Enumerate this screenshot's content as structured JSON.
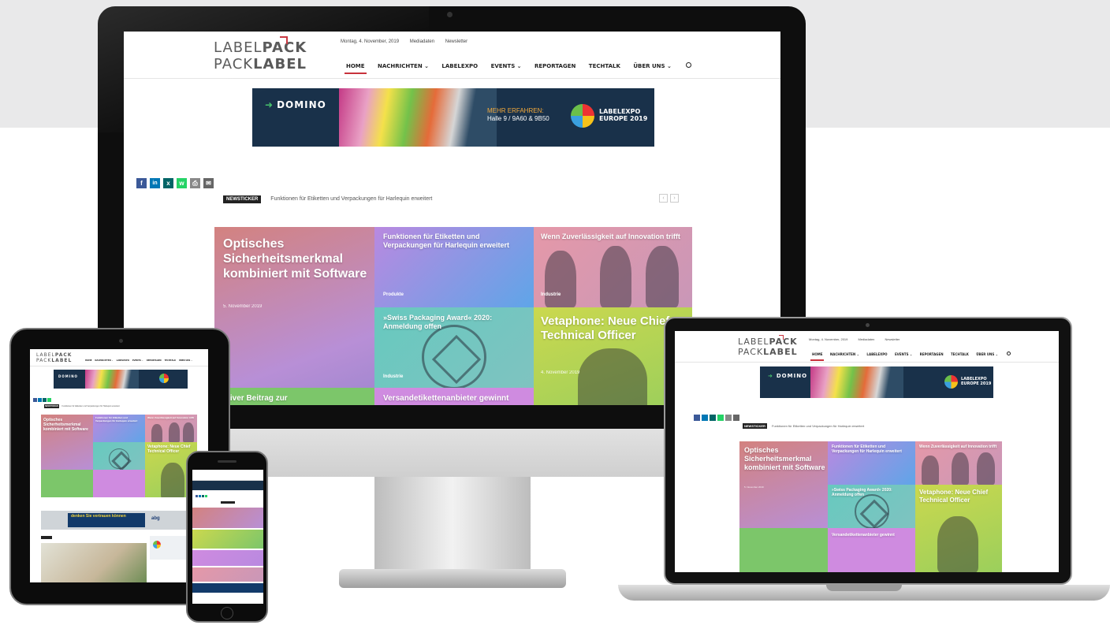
{
  "site": {
    "logo": {
      "line1_light": "LABEL",
      "line1_bold": "PACK",
      "line2_light": "PACK",
      "line2_bold": "LABEL"
    },
    "topbar": {
      "date": "Montag, 4. November, 2019",
      "mediadaten": "Mediadaten",
      "newsletter": "Newsletter"
    },
    "nav": [
      "HOME",
      "NACHRICHTEN ⌄",
      "LABELEXPO",
      "EVENTS ⌄",
      "REPORTAGEN",
      "TECHTALK",
      "ÜBER UNS ⌄"
    ],
    "banner": {
      "brand": "DOMINO",
      "cta_line1": "MEHR ERFAHREN:",
      "cta_line2": "Halle 9 / 9A60 & 9B50",
      "expo_line1": "LABELEXPO",
      "expo_line2": "EUROPE 2019"
    },
    "share_icons": [
      "f",
      "in",
      "x",
      "w",
      "⎙",
      "✉"
    ],
    "ticker": {
      "tag": "NEWSTICKER",
      "text": "Funktionen für Etiketten und Verpackungen für Harlequin erweitert",
      "prev": "‹",
      "next": "›"
    },
    "tiles": [
      {
        "title": "Optisches Sicherheitsmerkmal kombiniert mit Software",
        "date": "5. November 2019",
        "category": ""
      },
      {
        "title": "Funktionen für Etiketten und Verpackungen für Harlequin erweitert",
        "date": "",
        "category": "Produkte"
      },
      {
        "title": "Wenn Zuverlässigkeit auf Innovation trifft",
        "date": "",
        "category": "Industrie"
      },
      {
        "title": "»Swiss Packaging Award« 2020: Anmeldung offen",
        "date": "",
        "category": "Industrie"
      },
      {
        "title": "Vetaphone: Neue Chief Technical Officer",
        "date": "4. November 2019",
        "category": ""
      },
      {
        "title": "ktiver Beitrag zur",
        "date": "",
        "category": ""
      },
      {
        "title": "Versandetikettenanbieter gewinnt",
        "date": "",
        "category": ""
      }
    ],
    "ad_banner": {
      "text": "denken Sie vertrauen können",
      "brand": "abg"
    }
  },
  "colors": {
    "accent": "#c8323c",
    "banner_bg": "#19314a",
    "facebook": "#3b5998",
    "linkedin": "#0077b5",
    "xing": "#026466",
    "whatsapp": "#25d366",
    "print": "#888888",
    "email": "#666666"
  }
}
